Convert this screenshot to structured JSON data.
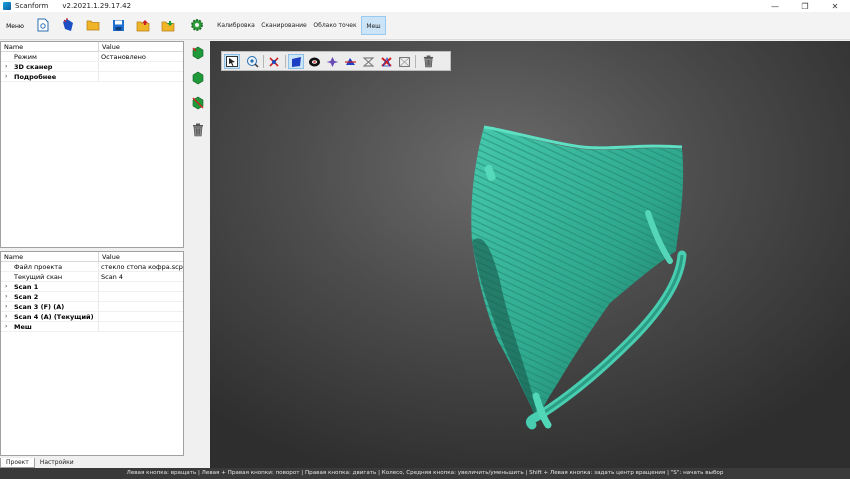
{
  "window": {
    "app_name": "Scanform",
    "version": "v2.2021.1.29.17.42",
    "controls": [
      "—",
      "❐",
      "✕"
    ]
  },
  "toolbar": {
    "menu_label": "Меню",
    "tabs": [
      {
        "label": "Калибровка",
        "active": false
      },
      {
        "label": "Сканирование",
        "active": false
      },
      {
        "label": "Облако точек",
        "active": false
      },
      {
        "label": "Меш",
        "active": true
      }
    ]
  },
  "scanner_panel": {
    "headers": {
      "name": "Name",
      "value": "Value"
    },
    "rows": [
      {
        "name": "Режим",
        "value": "Остановлено",
        "bold": false,
        "expandable": false
      },
      {
        "name": "3D сканер",
        "value": "",
        "bold": true,
        "expandable": true
      },
      {
        "name": "Подробнее",
        "value": "",
        "bold": true,
        "expandable": true
      }
    ]
  },
  "project_panel": {
    "headers": {
      "name": "Name",
      "value": "Value"
    },
    "rows": [
      {
        "name": "Файл проекта",
        "value": "стекло стопа кофра.scp",
        "bold": false,
        "expandable": false
      },
      {
        "name": "Текущий скан",
        "value": "Scan 4",
        "bold": false,
        "expandable": false
      },
      {
        "name": "Scan 1",
        "value": "",
        "bold": true,
        "expandable": true
      },
      {
        "name": "Scan 2",
        "value": "",
        "bold": true,
        "expandable": true
      },
      {
        "name": "Scan 3 (F) (A)",
        "value": "",
        "bold": true,
        "expandable": true
      },
      {
        "name": "Scan 4 (A) (Текущий)",
        "value": "",
        "bold": true,
        "expandable": true
      },
      {
        "name": "Меш",
        "value": "",
        "bold": true,
        "expandable": true
      }
    ]
  },
  "bottom_tabs": [
    {
      "label": "Проект",
      "active": true
    },
    {
      "label": "Настройки",
      "active": false
    }
  ],
  "statusbar": {
    "text": "Левая кнопка: вращать | Левая + Правая кнопки: поворот | Правая кнопка: двигать | Колесо, Средняя кнопка: увеличить/уменьшить | Shift + Левая кнопка: задать центр вращения | \"S\": начать выбор"
  },
  "colors": {
    "mesh": "#3fbfa4",
    "mesh_dark": "#1f6e5e",
    "accent_tab": "#cce4f7"
  }
}
